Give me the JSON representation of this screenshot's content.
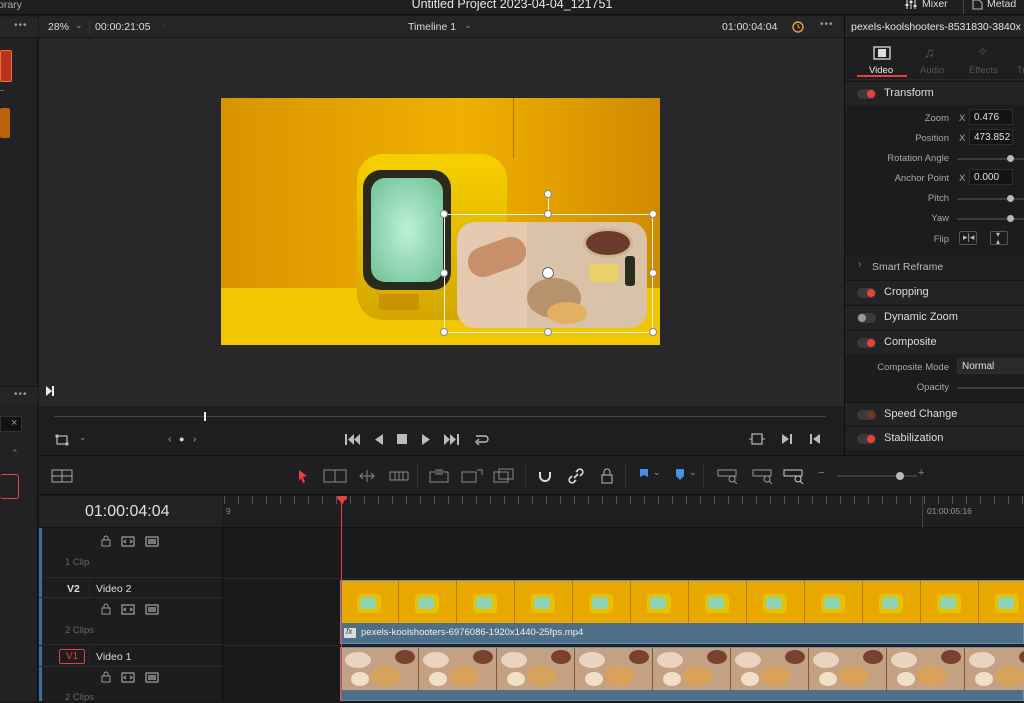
{
  "app": {
    "project_title": "Untitled Project 2023-04-04_121751",
    "left_tab_partial": "orary",
    "mixer_label": "Mixer",
    "metadata_partial": "Metad"
  },
  "viewer": {
    "zoom": "28%",
    "source_timecode": "00:00:21:05",
    "timeline_name": "Timeline 1",
    "record_timecode": "01:00:04:04"
  },
  "inspector": {
    "clip_title": "pexels-koolshooters-8531830-3840x",
    "tabs": [
      "Video",
      "Audio",
      "Effects",
      "Tr"
    ],
    "transform": {
      "title": "Transform",
      "zoom_label": "Zoom",
      "zoom_x": "0.476",
      "position_label": "Position",
      "position_x": "473.852",
      "rotation_label": "Rotation Angle",
      "anchor_label": "Anchor Point",
      "anchor_x": "0.000",
      "pitch_label": "Pitch",
      "yaw_label": "Yaw",
      "flip_label": "Flip",
      "axis_x": "X"
    },
    "smart_reframe": "Smart Reframe",
    "cropping": "Cropping",
    "dynamic_zoom": "Dynamic Zoom",
    "composite": {
      "title": "Composite",
      "mode_label": "Composite Mode",
      "mode_value": "Normal",
      "opacity_label": "Opacity"
    },
    "speed_change": "Speed Change",
    "stabilization": "Stabilization"
  },
  "timeline": {
    "current_timecode": "01:00:04:04",
    "ruler_start_partial": "9",
    "ruler_mark": "01:00:05:16",
    "tracks": [
      {
        "id": "",
        "name": "",
        "clips": "1 Clip"
      },
      {
        "id": "V2",
        "name": "Video 2",
        "clips": "2 Clips"
      },
      {
        "id": "V1",
        "name": "Video 1",
        "clips": "2 Clips"
      }
    ],
    "v2_clip_name": "pexels-koolshooters-6976086-1920x1440-25fps.mp4",
    "fx_badge": "fx"
  },
  "colors": {
    "accent_red": "#e8403a",
    "clip_blue": "#4d6f88",
    "playhead": "#e8403a",
    "tab_underline": "#e8403a"
  }
}
